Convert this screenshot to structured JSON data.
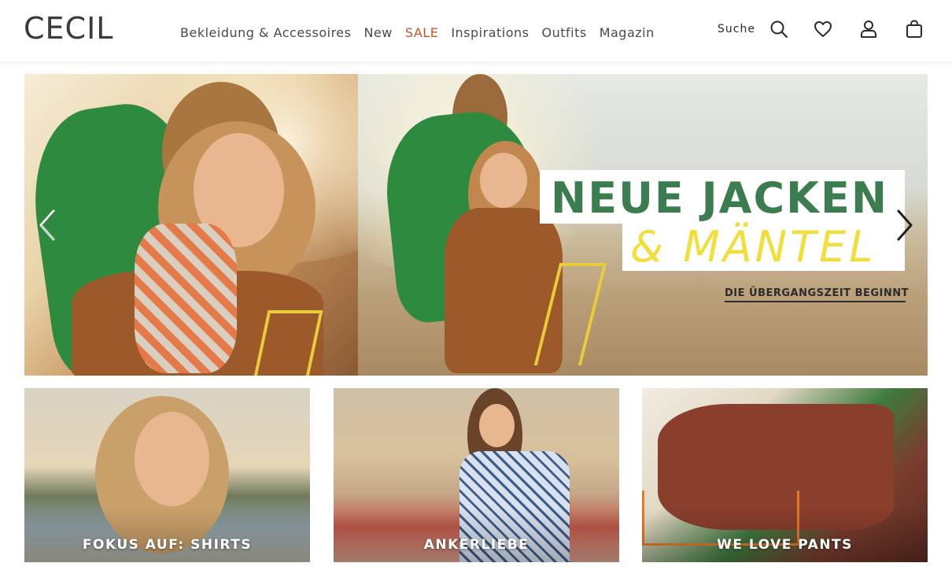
{
  "header": {
    "logo": "CECIL",
    "nav": [
      {
        "label": "Bekleidung & Accessoires"
      },
      {
        "label": "New"
      },
      {
        "label": "SALE"
      },
      {
        "label": "Inspirations"
      },
      {
        "label": "Outfits"
      },
      {
        "label": "Magazin"
      }
    ],
    "search_label": "Suche",
    "icons": [
      "search-icon",
      "heart-icon",
      "user-icon",
      "bag-icon"
    ]
  },
  "hero": {
    "headline_line1": "NEUE JACKEN",
    "headline_line2": "& MÄNTEL",
    "subline": "DIE ÜBERGANGSZEIT BEGINNT",
    "prev_icon": "chevron-left-icon",
    "next_icon": "chevron-right-icon"
  },
  "tiles": [
    {
      "label": "FOKUS AUF: SHIRTS"
    },
    {
      "label": "ANKERLIEBE"
    },
    {
      "label": "WE LOVE PANTS"
    }
  ],
  "colors": {
    "sale": "#c8552a",
    "headline_green": "#3c7d4f",
    "headline_yellow": "#f0de3a"
  }
}
